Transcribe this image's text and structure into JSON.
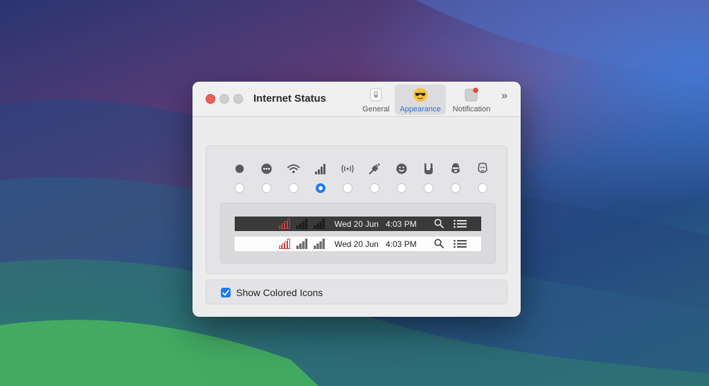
{
  "window": {
    "title": "Internet Status"
  },
  "toolbar": {
    "tabs": [
      {
        "label": "General",
        "icon": "switch-icon",
        "selected": false
      },
      {
        "label": "Appearance",
        "icon": "sunglasses-emoji-icon",
        "selected": true
      },
      {
        "label": "Notification",
        "icon": "notification-badge-icon",
        "selected": false
      }
    ],
    "overflow_icon": "chevron-double-right-icon"
  },
  "icon_styles": {
    "options": [
      {
        "icon": "dot-icon",
        "selected": false
      },
      {
        "icon": "ellipsis-circle-icon",
        "selected": false
      },
      {
        "icon": "wifi-icon",
        "selected": false
      },
      {
        "icon": "signal-bars-icon",
        "selected": true
      },
      {
        "icon": "antenna-icon",
        "selected": false
      },
      {
        "icon": "plug-icon",
        "selected": false
      },
      {
        "icon": "smiley-icon",
        "selected": false
      },
      {
        "icon": "rock-hand-icon",
        "selected": false
      },
      {
        "icon": "stormtrooper-icon",
        "selected": false
      },
      {
        "icon": "ironman-icon",
        "selected": false
      }
    ]
  },
  "preview": {
    "dark_bar": {
      "date": "Wed 20 Jun",
      "time": "4:03 PM"
    },
    "light_bar": {
      "date": "Wed 20 Jun",
      "time": "4:03 PM"
    }
  },
  "options": {
    "show_colored_icons": {
      "label": "Show Colored Icons",
      "checked": true
    }
  },
  "colors": {
    "accent": "#1c7af2",
    "close_button": "#ec5f57",
    "signal_alert": "#d23a3a",
    "dark_bar": "#3a3a3a"
  }
}
